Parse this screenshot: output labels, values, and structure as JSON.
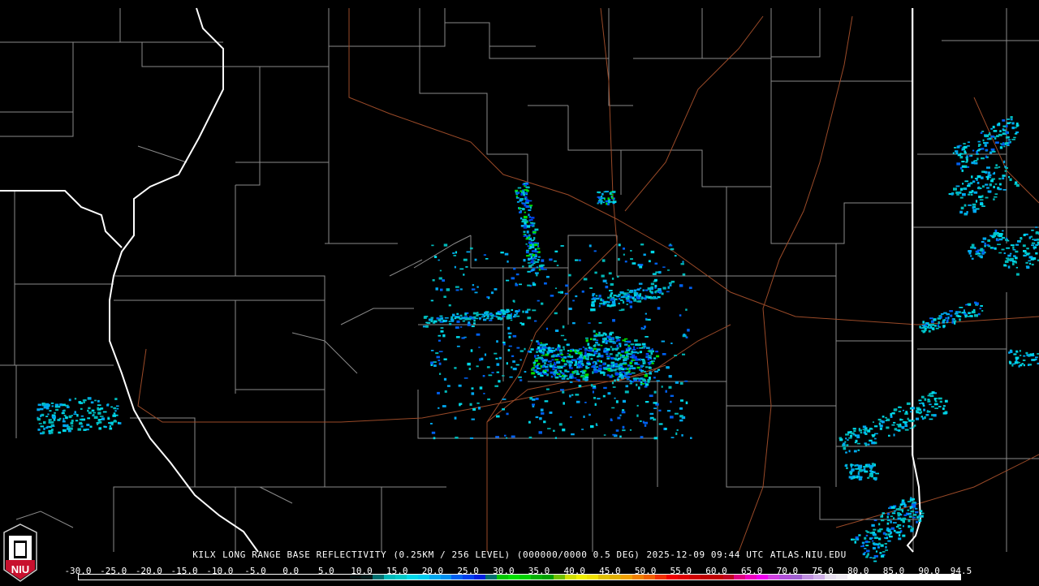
{
  "title": {
    "station": "KILX",
    "product": "LONG RANGE BASE REFLECTIVITY",
    "resolution": "(0.25KM / 256 LEVEL)",
    "volume": "(000000/0000 0.5 DEG)",
    "datetime": "2025-12-09 09:44 UTC",
    "site": "ATLAS.NIU.EDU"
  },
  "logo": {
    "text": "NIU"
  },
  "colorbar": {
    "labels": [
      "-30.0",
      "-25.0",
      "-20.0",
      "-15.0",
      "-10.0",
      "-5.0",
      "0.0",
      "5.0",
      "10.0",
      "15.0",
      "20.0",
      "25.0",
      "30.0",
      "35.0",
      "40.0",
      "45.0",
      "50.0",
      "55.0",
      "60.0",
      "65.0",
      "70.0",
      "75.0",
      "80.0",
      "85.0",
      "90.0",
      "94.5"
    ],
    "colors": [
      "#000000",
      "#000000",
      "#000000",
      "#000000",
      "#000000",
      "#000000",
      "#000000",
      "#000000",
      "#000000",
      "#000000",
      "#000000",
      "#000000",
      "#000000",
      "#000000",
      "#000000",
      "#000000",
      "#000000",
      "#000000",
      "#000000",
      "#000000",
      "#000000",
      "#000000",
      "#000000",
      "#000000",
      "#001010",
      "#001a1a",
      "#007070",
      "#00b8b8",
      "#00c8c8",
      "#00d8e8",
      "#00ccf0",
      "#00a8f0",
      "#0090f0",
      "#0060f0",
      "#0040f0",
      "#0020e0",
      "#007070",
      "#00c800",
      "#00e000",
      "#00d000",
      "#00b000",
      "#00a000",
      "#70c000",
      "#d0e000",
      "#f0f000",
      "#f0e000",
      "#e0c000",
      "#e0b000",
      "#f0a000",
      "#f08000",
      "#f06000",
      "#f03000",
      "#f00000",
      "#e00000",
      "#d00000",
      "#c00000",
      "#c00000",
      "#c00020",
      "#e00080",
      "#f000c0",
      "#f000f0",
      "#d040e0",
      "#b050d8",
      "#a060d0",
      "#c090e0",
      "#d0b0e8",
      "#e8e0f0",
      "#f0ecf4",
      "#ffffff",
      "#ffffff",
      "#ffffff",
      "#ffffff",
      "#ffffff",
      "#ffffff",
      "#ffffff",
      "#ffffff",
      "#ffffff",
      "#ffffff"
    ]
  },
  "colors": {
    "county": "#8a8a8a",
    "state": "#ffffff",
    "road": "#9a4a28"
  }
}
